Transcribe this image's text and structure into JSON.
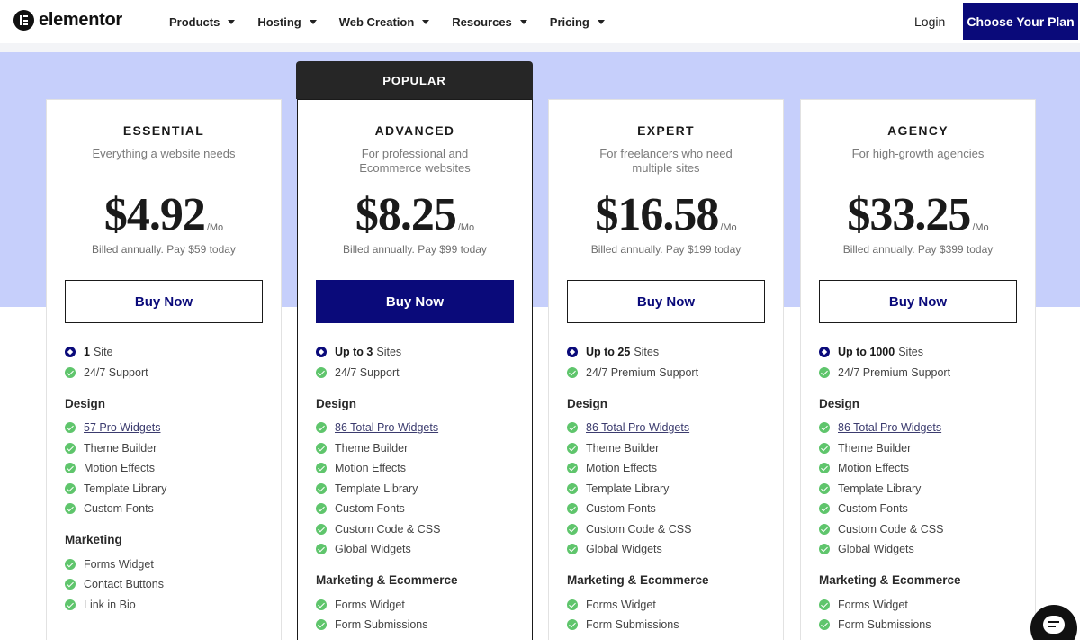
{
  "header": {
    "logo_text": "elementor",
    "nav": [
      "Products",
      "Hosting",
      "Web Creation",
      "Resources",
      "Pricing"
    ],
    "login": "Login",
    "cta": "Choose Your Plan"
  },
  "popular_label": "POPULAR",
  "plans": [
    {
      "name": "ESSENTIAL",
      "desc": "Everything a website needs",
      "price": "$4.92",
      "per": "/Mo",
      "billed": "Billed annually. Pay $59 today",
      "buy": "Buy Now",
      "features": [
        {
          "kind": "key",
          "bold": "1",
          "text": "Site"
        },
        {
          "kind": "item",
          "text": "24/7 Support"
        },
        {
          "kind": "section",
          "text": "Design"
        },
        {
          "kind": "item",
          "text": "57 Pro Widgets",
          "link": true
        },
        {
          "kind": "item",
          "text": "Theme Builder"
        },
        {
          "kind": "item",
          "text": "Motion Effects"
        },
        {
          "kind": "item",
          "text": "Template Library"
        },
        {
          "kind": "item",
          "text": "Custom Fonts"
        },
        {
          "kind": "section",
          "text": "Marketing"
        },
        {
          "kind": "item",
          "text": "Forms Widget"
        },
        {
          "kind": "item",
          "text": "Contact Buttons"
        },
        {
          "kind": "item",
          "text": "Link in Bio"
        }
      ]
    },
    {
      "name": "ADVANCED",
      "desc": "For professional and Ecommerce websites",
      "price": "$8.25",
      "per": "/Mo",
      "billed": "Billed annually. Pay $99 today",
      "buy": "Buy Now",
      "features": [
        {
          "kind": "key",
          "bold": "Up to 3",
          "text": "Sites"
        },
        {
          "kind": "item",
          "text": "24/7 Support"
        },
        {
          "kind": "section",
          "text": "Design"
        },
        {
          "kind": "item",
          "text": "86 Total Pro Widgets",
          "link": true
        },
        {
          "kind": "item",
          "text": "Theme Builder"
        },
        {
          "kind": "item",
          "text": "Motion Effects"
        },
        {
          "kind": "item",
          "text": "Template Library"
        },
        {
          "kind": "item",
          "text": "Custom Fonts"
        },
        {
          "kind": "item",
          "text": "Custom Code & CSS"
        },
        {
          "kind": "item",
          "text": "Global Widgets"
        },
        {
          "kind": "section",
          "text": "Marketing & Ecommerce"
        },
        {
          "kind": "item",
          "text": "Forms Widget"
        },
        {
          "kind": "item",
          "text": "Form Submissions"
        }
      ]
    },
    {
      "name": "EXPERT",
      "desc": "For freelancers who need multiple sites",
      "price": "$16.58",
      "per": "/Mo",
      "billed": "Billed annually. Pay $199 today",
      "buy": "Buy Now",
      "features": [
        {
          "kind": "key",
          "bold": "Up to 25",
          "text": "Sites"
        },
        {
          "kind": "item",
          "text": "24/7 Premium Support"
        },
        {
          "kind": "section",
          "text": "Design"
        },
        {
          "kind": "item",
          "text": "86 Total Pro Widgets",
          "link": true
        },
        {
          "kind": "item",
          "text": "Theme Builder"
        },
        {
          "kind": "item",
          "text": "Motion Effects"
        },
        {
          "kind": "item",
          "text": "Template Library"
        },
        {
          "kind": "item",
          "text": "Custom Fonts"
        },
        {
          "kind": "item",
          "text": "Custom Code & CSS"
        },
        {
          "kind": "item",
          "text": "Global Widgets"
        },
        {
          "kind": "section",
          "text": "Marketing & Ecommerce"
        },
        {
          "kind": "item",
          "text": "Forms Widget"
        },
        {
          "kind": "item",
          "text": "Form Submissions"
        }
      ]
    },
    {
      "name": "AGENCY",
      "desc": "For high-growth agencies",
      "price": "$33.25",
      "per": "/Mo",
      "billed": "Billed annually. Pay $399 today",
      "buy": "Buy Now",
      "features": [
        {
          "kind": "key",
          "bold": "Up to 1000",
          "text": "Sites"
        },
        {
          "kind": "item",
          "text": "24/7 Premium Support"
        },
        {
          "kind": "section",
          "text": "Design"
        },
        {
          "kind": "item",
          "text": "86 Total Pro Widgets",
          "link": true
        },
        {
          "kind": "item",
          "text": "Theme Builder"
        },
        {
          "kind": "item",
          "text": "Motion Effects"
        },
        {
          "kind": "item",
          "text": "Template Library"
        },
        {
          "kind": "item",
          "text": "Custom Fonts"
        },
        {
          "kind": "item",
          "text": "Custom Code & CSS"
        },
        {
          "kind": "item",
          "text": "Global Widgets"
        },
        {
          "kind": "section",
          "text": "Marketing & Ecommerce"
        },
        {
          "kind": "item",
          "text": "Forms Widget"
        },
        {
          "kind": "item",
          "text": "Form Submissions"
        }
      ]
    }
  ],
  "colors": {
    "brand_navy": "#0a0a7a",
    "band_blue": "#c6cffb",
    "check_green": "#5fc56c",
    "popular_tab": "#262626"
  },
  "icons": {
    "logo": "elementor-logo-icon",
    "chat": "chat-icon",
    "check": "check-circle-icon",
    "key": "diamond-icon"
  }
}
